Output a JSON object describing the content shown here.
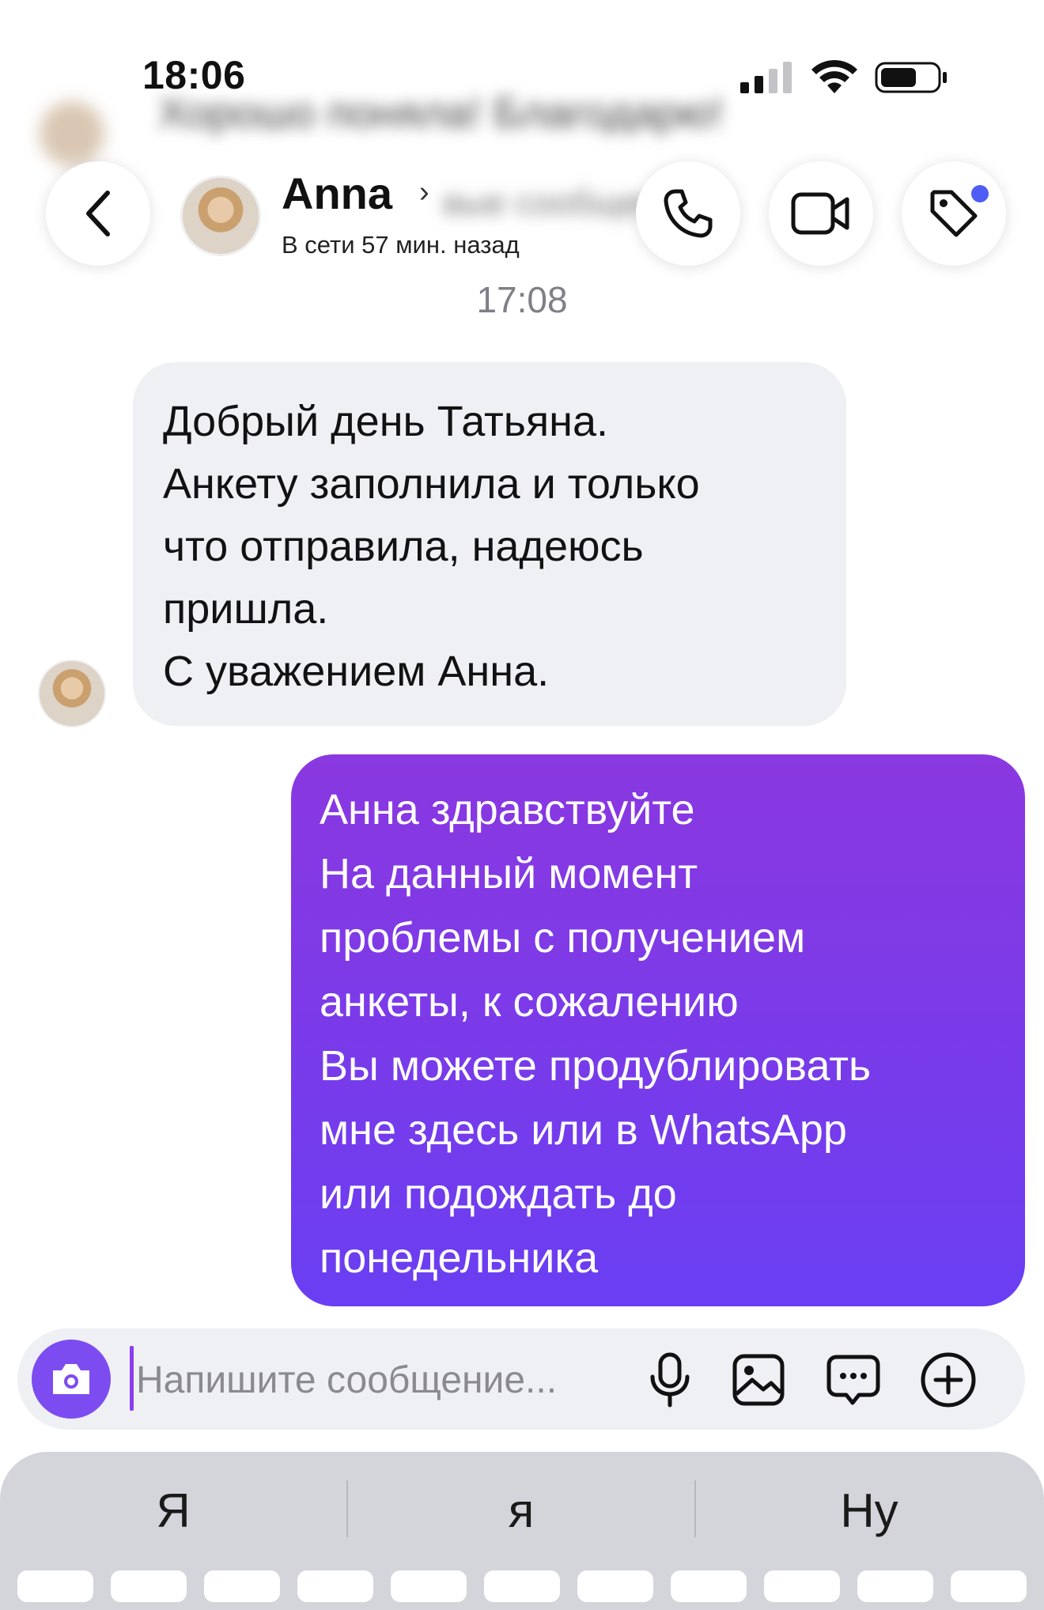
{
  "status_bar": {
    "time": "18:06"
  },
  "previous_message_blurred": "Хорошо поняла! Благодарю!",
  "previous_reply_blurred": "вые сообщения",
  "header": {
    "contact_name": "Anna",
    "name_chevron": "›",
    "contact_status": "В сети 57 мин. назад"
  },
  "timestamp": "17:08",
  "messages": [
    {
      "direction": "incoming",
      "text": "Добрый день Татьяна.\nАнкету заполнила и только\nчто отправила, надеюсь\nпришла.\nС уважением Анна."
    },
    {
      "direction": "outgoing",
      "text": "Анна здравствуйте\nНа данный момент\nпроблемы с получением\nанкеты, к сожалению\nВы можете продублировать\nмне здесь или в WhatsApp\nили подождать до\nпонедельника"
    }
  ],
  "composer": {
    "placeholder": "Напишите сообщение..."
  },
  "keyboard_suggestions": [
    "Я",
    "я",
    "Ну"
  ],
  "colors": {
    "outgoing_bubble_top": "#8a38e0",
    "outgoing_bubble_bottom": "#6a3ef2",
    "incoming_bubble": "#eff0f4",
    "camera_button": "#7d4cf0",
    "notification_dot": "#4f5cf5"
  },
  "icons": [
    "back-icon",
    "phone-icon",
    "video-camera-icon",
    "tag-icon",
    "camera-icon",
    "microphone-icon",
    "gallery-icon",
    "sticker-icon",
    "plus-icon",
    "signal-icon",
    "wifi-icon",
    "battery-icon"
  ]
}
